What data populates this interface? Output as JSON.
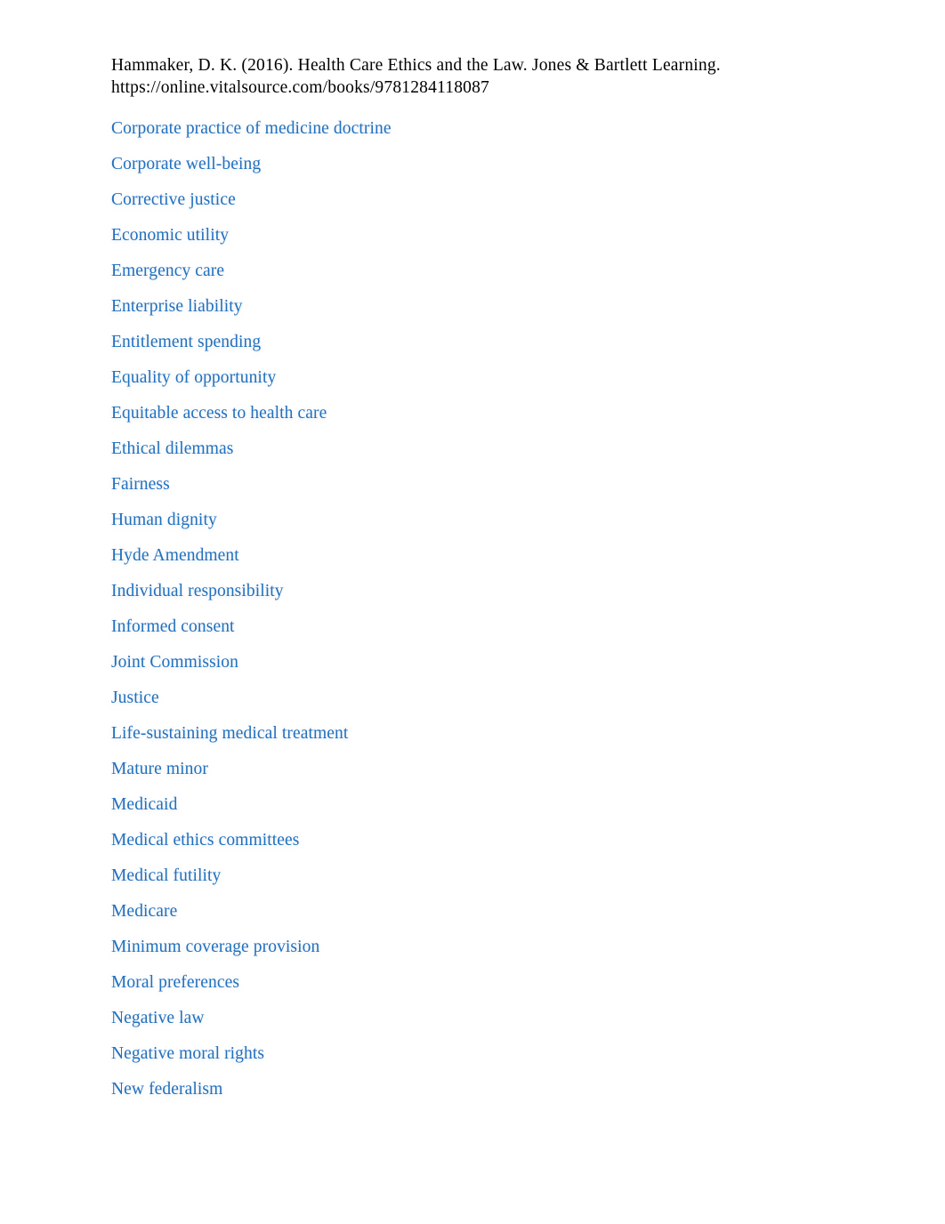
{
  "document": {
    "citation": {
      "line1": "Hammaker, D. K. (2016). Health Care Ethics and the Law. Jones & Bartlett Learning.",
      "line2": "https://online.vitalsource.com/books/9781284118087"
    },
    "link_color": "#2070c0",
    "text_color": "#000000",
    "background_color": "#ffffff"
  },
  "keyword_list": [
    {
      "label": "Corporate practice of medicine doctrine"
    },
    {
      "label": "Corporate well-being"
    },
    {
      "label": "Corrective justice"
    },
    {
      "label": "Economic utility"
    },
    {
      "label": "Emergency care"
    },
    {
      "label": "Enterprise liability"
    },
    {
      "label": "Entitlement spending"
    },
    {
      "label": "Equality of opportunity"
    },
    {
      "label": "Equitable access to health care"
    },
    {
      "label": "Ethical dilemmas"
    },
    {
      "label": "Fairness"
    },
    {
      "label": "Human dignity"
    },
    {
      "label": "Hyde Amendment"
    },
    {
      "label": "Individual responsibility"
    },
    {
      "label": "Informed consent"
    },
    {
      "label": "Joint Commission"
    },
    {
      "label": "Justice"
    },
    {
      "label": "Life-sustaining medical treatment"
    },
    {
      "label": "Mature minor"
    },
    {
      "label": "Medicaid"
    },
    {
      "label": "Medical ethics committees"
    },
    {
      "label": "Medical futility"
    },
    {
      "label": "Medicare"
    },
    {
      "label": "Minimum coverage provision"
    },
    {
      "label": "Moral preferences"
    },
    {
      "label": "Negative law"
    },
    {
      "label": "Negative moral rights"
    },
    {
      "label": "New federalism"
    }
  ]
}
